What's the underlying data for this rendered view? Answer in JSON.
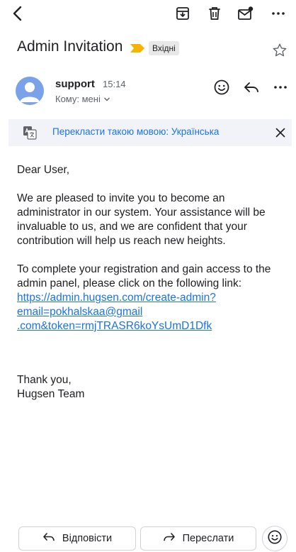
{
  "toolbar": {
    "back_icon": "back-arrow-icon",
    "archive_icon": "archive-icon",
    "delete_icon": "trash-icon",
    "mark_unread_icon": "mark-unread-icon",
    "more_icon": "more-horizontal-icon"
  },
  "email": {
    "subject": "Admin Invitation",
    "label": "Вхідні",
    "sender": "support",
    "time": "15:14",
    "recipient": "Кому: мені"
  },
  "translate": {
    "text": "Перекласти такою мовою: Українська"
  },
  "body": {
    "greeting": "Dear User,",
    "paragraph1": "We are pleased to invite you to become an administrator in our system. Your assistance will be invaluable to us, and we are confident that your contribution will help us reach new heights.",
    "paragraph2": "To complete your registration and gain access to the admin panel, please click on the following link:",
    "link_line1": "https://admin.hugsen.com/create-admin?",
    "link_line2": "email=pokhalskaa@gmail",
    "link_line3": ".com&token=rmjTRASR6koYsUmD1Dfk",
    "thanks": "Thank you,",
    "team": "Hugsen Team"
  },
  "actions": {
    "reply_label": "Відповісти",
    "forward_label": "Переслати"
  },
  "colors": {
    "accent": "#1a73e8",
    "importance": "#f4b400",
    "avatar": "#7aa2e8"
  }
}
